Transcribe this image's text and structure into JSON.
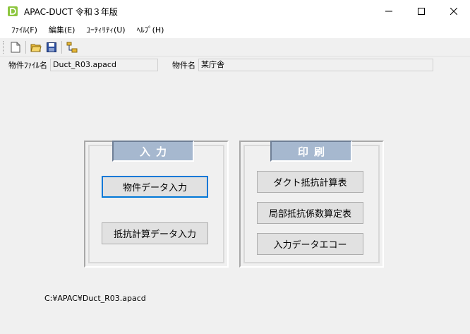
{
  "window": {
    "title": "APAC-DUCT 令和３年版"
  },
  "menu": [
    {
      "label": "ﾌｧｲﾙ(F)"
    },
    {
      "label": "編集(E)"
    },
    {
      "label": "ﾕｰﾃｨﾘﾃｨ(U)"
    },
    {
      "label": "ﾍﾙﾌﾟ(H)"
    }
  ],
  "info": {
    "file_label": "物件ﾌｧｲﾙ名",
    "file_value": "Duct_R03.apacd",
    "name_label": "物件名",
    "name_value": "某庁舎"
  },
  "input_group": {
    "title": "入力",
    "buttons": [
      "物件データ入力",
      "抵抗計算データ入力"
    ]
  },
  "print_group": {
    "title": "印刷",
    "buttons": [
      "ダクト抵抗計算表",
      "局部抵抗係数算定表",
      "入力データエコー"
    ]
  },
  "status_path": "C:¥APAC¥Duct_R03.apacd",
  "colors": {
    "group_title_bg": "#a6b8cf",
    "default_button_border": "#0078d7"
  }
}
